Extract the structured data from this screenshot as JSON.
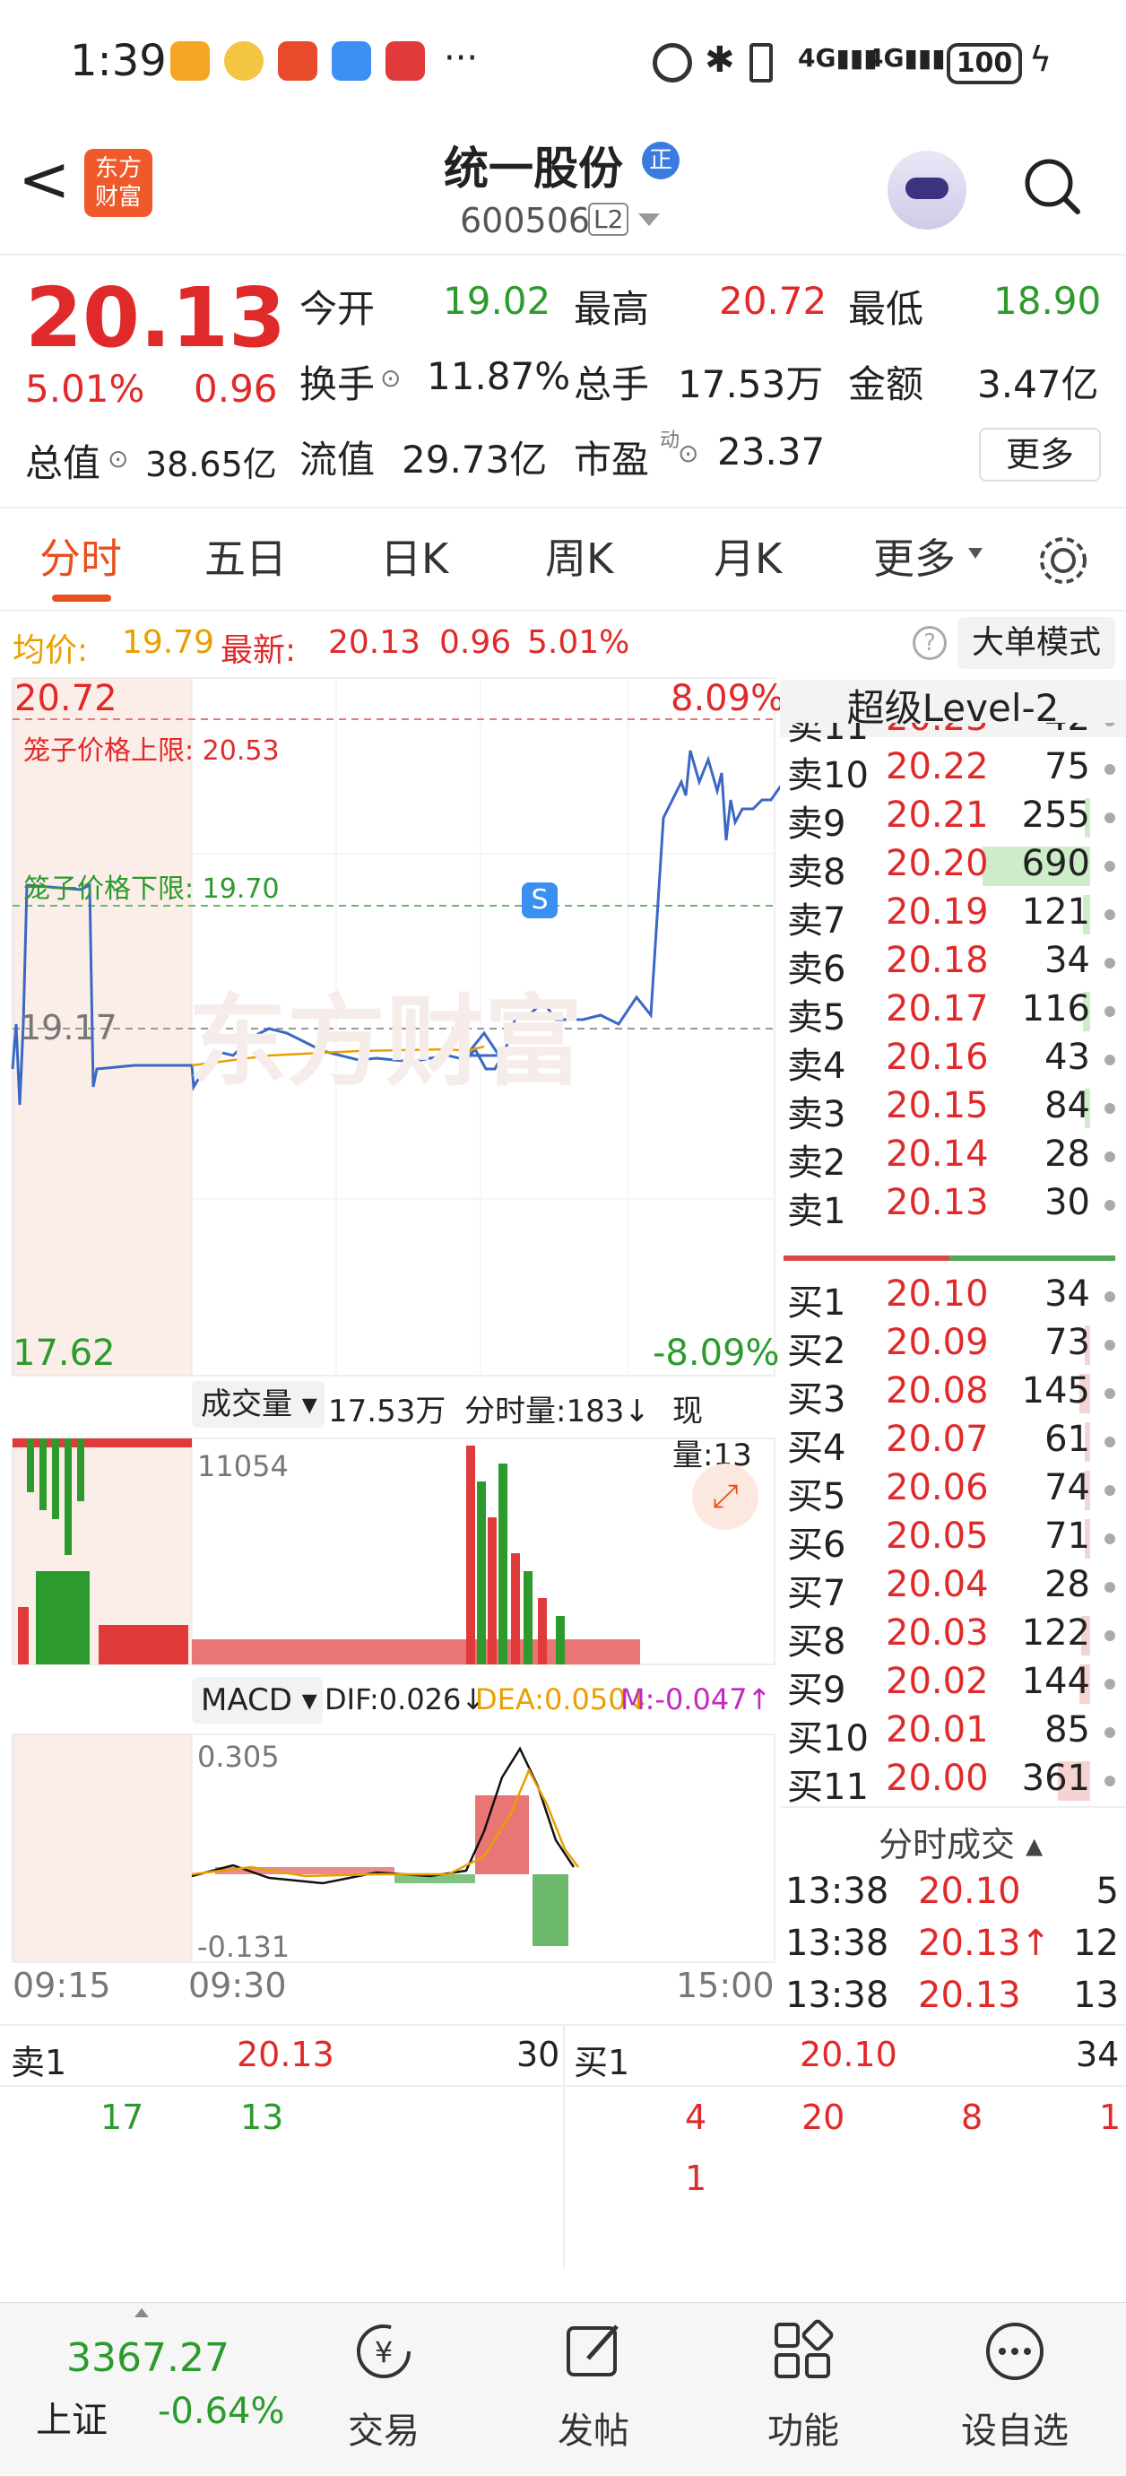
{
  "status_bar": {
    "time": "1:39",
    "more": "···",
    "battery": "100"
  },
  "header": {
    "back": "<",
    "logo_line1": "东方",
    "logo_line2": "财富",
    "title": "统一股份",
    "badge": "正",
    "code": "600506",
    "level": "L2"
  },
  "quote": {
    "price": "20.13",
    "pct": "5.01%",
    "change": "0.96",
    "open_label": "今开",
    "open": "19.02",
    "high_label": "最高",
    "high": "20.72",
    "low_label": "最低",
    "low": "18.90",
    "turnover_label": "换手",
    "turnover": "11.87%",
    "volume_label": "总手",
    "volume": "17.53万",
    "amount_label": "金额",
    "amount": "3.47亿",
    "mktcap_label": "总值",
    "mktcap": "38.65亿",
    "float_label": "流值",
    "float": "29.73亿",
    "pe_label": "市盈",
    "pe_sup": "动",
    "pe": "23.37",
    "more_button": "更多"
  },
  "tabs": [
    "分时",
    "五日",
    "日K",
    "周K",
    "月K",
    "更多"
  ],
  "avg_line": {
    "avg_label": "均价:",
    "avg": "19.79",
    "latest_label": "最新:",
    "latest": "20.13",
    "chg": "0.96",
    "pct": "5.01%",
    "help": "?",
    "mode_button": "大单模式"
  },
  "chart": {
    "top_price": "20.72",
    "top_pct": "8.09%",
    "bottom_price": "17.62",
    "bottom_pct": "-8.09%",
    "mid_price": "19.17",
    "cage_upper": "笼子价格上限:  20.53",
    "cage_lower": "笼子价格下限:  19.70",
    "watermark": "东方财富",
    "s_marker": "S",
    "vol_label": "成交量",
    "vol_total": "17.53万",
    "vol_tick_label": "分时量:183↓",
    "vol_now": "现量:13",
    "vol_max": "11054",
    "macd_label": "MACD",
    "dif": "DIF:0.026↓",
    "dea": "DEA:0.050↓",
    "m": "M:-0.047↑",
    "macd_top": "0.305",
    "macd_bottom": "-0.131",
    "times": [
      "09:15",
      "09:30",
      "15:00"
    ]
  },
  "level2": {
    "title": "超级Level-2",
    "asks": [
      {
        "label": "卖11",
        "price": "20.23",
        "vol": "42",
        "bar": 0
      },
      {
        "label": "卖10",
        "price": "20.22",
        "vol": "75",
        "bar": 0
      },
      {
        "label": "卖9",
        "price": "20.21",
        "vol": "255",
        "bar": 0.05
      },
      {
        "label": "卖8",
        "price": "20.20",
        "vol": "690",
        "bar": 1
      },
      {
        "label": "卖7",
        "price": "20.19",
        "vol": "121",
        "bar": 0.07
      },
      {
        "label": "卖6",
        "price": "20.18",
        "vol": "34",
        "bar": 0
      },
      {
        "label": "卖5",
        "price": "20.17",
        "vol": "116",
        "bar": 0.07
      },
      {
        "label": "卖4",
        "price": "20.16",
        "vol": "43",
        "bar": 0
      },
      {
        "label": "卖3",
        "price": "20.15",
        "vol": "84",
        "bar": 0.05
      },
      {
        "label": "卖2",
        "price": "20.14",
        "vol": "28",
        "bar": 0
      },
      {
        "label": "卖1",
        "price": "20.13",
        "vol": "30",
        "bar": 0
      }
    ],
    "bids": [
      {
        "label": "买1",
        "price": "20.10",
        "vol": "34",
        "bar": 0
      },
      {
        "label": "买2",
        "price": "20.09",
        "vol": "73",
        "bar": 0.05
      },
      {
        "label": "买3",
        "price": "20.08",
        "vol": "145",
        "bar": 0.1
      },
      {
        "label": "买4",
        "price": "20.07",
        "vol": "61",
        "bar": 0.05
      },
      {
        "label": "买5",
        "price": "20.06",
        "vol": "74",
        "bar": 0.05
      },
      {
        "label": "买6",
        "price": "20.05",
        "vol": "71",
        "bar": 0.05
      },
      {
        "label": "买7",
        "price": "20.04",
        "vol": "28",
        "bar": 0
      },
      {
        "label": "买8",
        "price": "20.03",
        "vol": "122",
        "bar": 0.08
      },
      {
        "label": "买9",
        "price": "20.02",
        "vol": "144",
        "bar": 0.1
      },
      {
        "label": "买10",
        "price": "20.01",
        "vol": "85",
        "bar": 0
      },
      {
        "label": "买11",
        "price": "20.00",
        "vol": "361",
        "bar": 0.3
      }
    ],
    "trades_title": "分时成交",
    "trades": [
      {
        "time": "13:38",
        "price": "20.10",
        "vol": "5"
      },
      {
        "time": "13:38",
        "price": "20.13↑",
        "vol": "12"
      },
      {
        "time": "13:38",
        "price": "20.13",
        "vol": "13"
      }
    ]
  },
  "bottom_quote": {
    "ask_label": "卖1",
    "ask_price": "20.13",
    "ask_vol": "30",
    "bid_label": "买1",
    "bid_price": "20.10",
    "bid_vol": "34",
    "ask_orders": [
      "17",
      "13"
    ],
    "bid_orders": [
      "4",
      "20",
      "8",
      "1",
      "1"
    ]
  },
  "nav": {
    "index_value": "3367.27",
    "index_name": "上证",
    "index_pct": "-0.64%",
    "items": [
      "交易",
      "发帖",
      "功能",
      "设自选"
    ]
  }
}
